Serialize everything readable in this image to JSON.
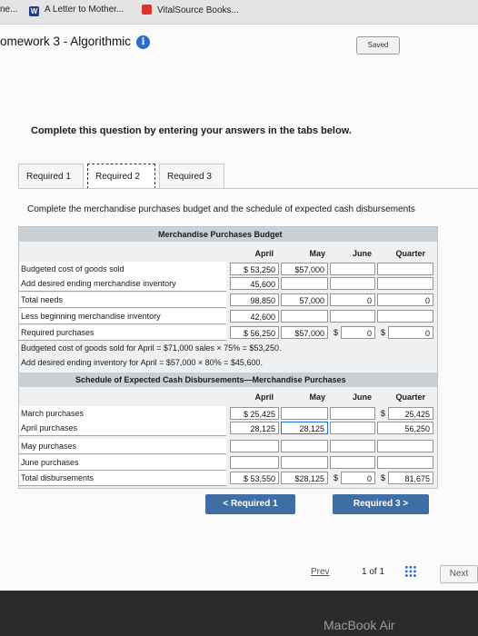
{
  "browser_tabs": [
    "ne...",
    "A Letter to Mother...",
    "VitalSource Books..."
  ],
  "header": {
    "title": "omework 3 - Algorithmic",
    "info_icon": "i",
    "saved_label": "Saved"
  },
  "instruction": "Complete this question by entering your answers in the tabs below.",
  "required_tabs": [
    "Required 1",
    "Required 2",
    "Required 3"
  ],
  "panel_text": "Complete the merchandise purchases budget and the schedule of expected cash disbursements",
  "budget": {
    "title": "Merchandise Purchases Budget",
    "columns": [
      "April",
      "May",
      "June",
      "Quarter"
    ],
    "rows": [
      {
        "label": "Budgeted cost of goods sold",
        "values": [
          "$ 53,250",
          "$57,000",
          "",
          ""
        ]
      },
      {
        "label": "Add desired ending merchandise inventory",
        "values": [
          "45,600",
          "",
          "",
          ""
        ]
      },
      {
        "label": "Total needs",
        "values": [
          "98,850",
          "57,000",
          "0",
          "0"
        ]
      },
      {
        "label": "Less beginning merchandise inventory",
        "values": [
          "42,600",
          "",
          "",
          ""
        ]
      },
      {
        "label": "Required purchases",
        "values": [
          "$ 56,250",
          "$57,000",
          "0",
          "0"
        ]
      }
    ],
    "dollar_sign": "$",
    "notes": [
      "Budgeted cost of goods sold for April = $71,000 sales × 75% = $53,250.",
      "Add desired ending inventory for April = $57,000 × 80% = $45,600."
    ]
  },
  "schedule": {
    "title": "Schedule of Expected Cash Disbursements—Merchandise Purchases",
    "columns": [
      "April",
      "May",
      "June",
      "Quarter"
    ],
    "rows": [
      {
        "label": "March purchases",
        "values": [
          "$ 25,425",
          "",
          "",
          "25,425"
        ]
      },
      {
        "label": "April purchases",
        "values": [
          "28,125",
          "28,125",
          "",
          "56,250"
        ]
      },
      {
        "label": "May purchases",
        "values": [
          "",
          "",
          "",
          ""
        ]
      },
      {
        "label": "June purchases",
        "values": [
          "",
          "",
          "",
          ""
        ]
      },
      {
        "label": "Total disbursements",
        "values": [
          "$ 53,550",
          "$28,125",
          "0",
          "81,675"
        ]
      }
    ],
    "dollar_sign": "$"
  },
  "nav": {
    "prev_label": "< Required 1",
    "next_label": "Required 3 >"
  },
  "footer": {
    "prev": "Prev",
    "page_info": "1 of 1",
    "next": "Next"
  },
  "bezel": "MacBook Air"
}
